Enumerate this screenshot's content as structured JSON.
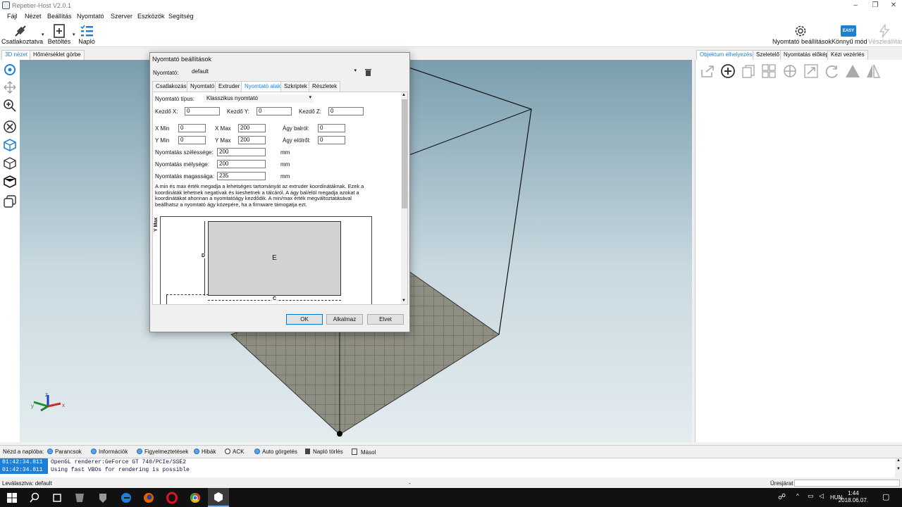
{
  "window": {
    "title": "Repetier-Host V2.0.1",
    "controls": [
      "–",
      "❐",
      "✕"
    ]
  },
  "menu": [
    "Fájl",
    "Nézet",
    "Beállítás",
    "Nyomtató",
    "Szerver",
    "Eszközök",
    "Segítség"
  ],
  "toolbar": {
    "connect": "Csatlakoztatva",
    "load": "Betöltés",
    "log": "Napló",
    "printer_settings": "Nyomtató beállítások",
    "easy_mode": "Könnyű mód",
    "easy_badge": "EASY",
    "emergency": "Vészleállítás"
  },
  "left_tabs": [
    "3D nézet",
    "Hőmérséklet görbe"
  ],
  "right_tabs": [
    "Objektum elhelyezése",
    "Szeletelő",
    "Nyomtatás előkép",
    "Kézi vezérlés"
  ],
  "dialog": {
    "title": "Nyomtató beállítások",
    "printer_label": "Nyomtató:",
    "printer_value": "default",
    "tabs": [
      "Csatlakozás",
      "Nyomtató",
      "Extruder",
      "Nyomtató alak",
      "Szkriptek",
      "Részletek"
    ],
    "active_tab": "Nyomtató alak",
    "printer_type_label": "Nyomtató típus:",
    "printer_type_value": "Klasszikus nyomtató",
    "home_x_label": "Kezdő X:",
    "home_x": "0",
    "home_y_label": "Kezdő Y:",
    "home_y": "0",
    "home_z_label": "Kezdő Z:",
    "home_z": "0",
    "xmin_label": "X Min",
    "xmin": "0",
    "xmax_label": "X Max",
    "xmax": "200",
    "bed_left_label": "Ágy balról:",
    "bed_left": "0",
    "ymin_label": "Y Min",
    "ymin": "0",
    "ymax_label": "Y Max",
    "ymax": "200",
    "bed_front_label": "Ágy elölről:",
    "bed_front": "0",
    "width_label": "Nyomtatás szélessége:",
    "width": "200",
    "depth_label": "Nyomtatás mélysége:",
    "depth": "200",
    "height_label": "Nyomtatás magassága:",
    "height": "235",
    "unit": "mm",
    "description_lines": [
      "A min és max érték megadja a lehetséges tartományát az extruder koordinátáknak.  Ezek a",
      "koordináták lehetnek negatívak és kieshetnek a tálcáról. A ágy bal/elöl megadja azokat a",
      "koordinátákat ahonnan a nyomtatóágy kezdődik.  A min/max érték megváltoztatásával",
      "beállhatsz a nyomtató ágy közepére, ha a firmware támogatja ezt."
    ],
    "diagram": {
      "ymax_label": "Y Max",
      "center_label": "E",
      "d_label": "D",
      "c_label": "C"
    },
    "buttons": {
      "ok": "OK",
      "apply": "Alkalmaz",
      "cancel": "Elvet"
    }
  },
  "logbar": {
    "label": "Nézd a naplóba:",
    "options": [
      {
        "label": "Parancsok",
        "checked": true
      },
      {
        "label": "Információk",
        "checked": true
      },
      {
        "label": "Figyelmeztetések",
        "checked": true
      },
      {
        "label": "Hibák",
        "checked": true
      },
      {
        "label": "ACK",
        "checked": false
      },
      {
        "label": "Auto görgetés",
        "checked": true
      }
    ],
    "clear": "Napló törlés",
    "copy": "Másol"
  },
  "log": [
    {
      "time": "01:42:34.811",
      "message": "OpenGL renderer:GeForce GT 740/PCIe/SSE2"
    },
    {
      "time": "01:42:34.811",
      "message": "Using fast VBOs for rendering is possible"
    }
  ],
  "status": {
    "left": "Leválasztva: default",
    "middle": "-",
    "right": "Üresjárat"
  },
  "taskbar": {
    "lang": "HUN",
    "time": "1:44",
    "date": "2018.06.07."
  },
  "colors": {
    "accent": "#1e7fd6",
    "view_top": "#7a9eae",
    "view_bottom": "#e4ecef"
  }
}
